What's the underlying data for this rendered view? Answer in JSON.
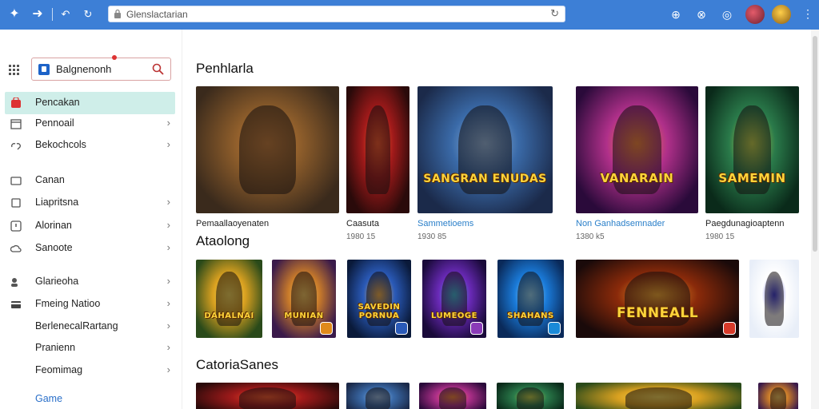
{
  "browser": {
    "url": "Glenslactarian",
    "icons": [
      "sparkle-icon",
      "forward-arrow-icon",
      "back-icon",
      "refresh-icon",
      "lock-icon",
      "reload-icon",
      "zoom-icon",
      "extension-icon",
      "settings-icon",
      "more-icon"
    ]
  },
  "sidebar": {
    "search_value": "Balgnenonh",
    "items": [
      {
        "label": "Pencakan",
        "icon": "shop-icon",
        "active": true,
        "chevron": false
      },
      {
        "label": "Pennoail",
        "icon": "calendar-icon",
        "active": false,
        "chevron": true
      },
      {
        "label": "Bekochcols",
        "icon": "link-icon",
        "active": false,
        "chevron": true
      },
      {
        "label": "Canan",
        "icon": "card-icon",
        "active": false,
        "chevron": false
      },
      {
        "label": "Liapritsna",
        "icon": "square-icon",
        "active": false,
        "chevron": true
      },
      {
        "label": "Alorinan",
        "icon": "info-icon",
        "active": false,
        "chevron": true
      },
      {
        "label": "Sanoote",
        "icon": "cloud-icon",
        "active": false,
        "chevron": true
      },
      {
        "label": "Glarieoha",
        "icon": "people-icon",
        "active": false,
        "chevron": true
      },
      {
        "label": "Fmeing Natioo",
        "icon": "wallet-icon",
        "active": false,
        "chevron": true
      },
      {
        "label": "BerlenecalRartang",
        "icon": "",
        "active": false,
        "chevron": true
      },
      {
        "label": "Pranienn",
        "icon": "",
        "active": false,
        "chevron": true
      },
      {
        "label": "Feomimag",
        "icon": "",
        "active": false,
        "chevron": true
      }
    ],
    "footer_link": "Game"
  },
  "sections": [
    {
      "title": "Penhlarla"
    },
    {
      "title": "Ataolong"
    },
    {
      "title": "CatoriaSanes"
    }
  ],
  "featured": [
    {
      "title": "Pemaallaoyenaten",
      "sub": "",
      "banner": "",
      "highlight": false
    },
    {
      "title": "Caasuta",
      "sub": "1980 15",
      "banner": "",
      "highlight": false
    },
    {
      "title": "Sammetioems",
      "sub": "1930 85",
      "banner": "SANGRAN ENUDAS",
      "highlight": true
    },
    {
      "title": "Non Ganhadsemnader",
      "sub": "1380 k5",
      "banner": "VANARAIN",
      "highlight": true
    },
    {
      "title": "Paegdunagioaptenn",
      "sub": "1980 15",
      "banner": "SAMEMIN",
      "highlight": false
    }
  ],
  "row2": [
    {
      "banner": "DAHALNAI"
    },
    {
      "banner": "MUNIAN"
    },
    {
      "banner": "SAVEDIN PORNUA"
    },
    {
      "banner": "LUMEOGE"
    },
    {
      "banner": "SHAHANS"
    },
    {
      "banner": "FENNEALL"
    },
    {
      "banner": ""
    }
  ],
  "row3": [
    {
      "banner": ""
    },
    {
      "banner": ""
    },
    {
      "banner": ""
    },
    {
      "banner": ""
    },
    {
      "banner": ""
    },
    {
      "banner": ""
    }
  ],
  "colors": {
    "chrome": "#3d7fd6",
    "active_item": "#cfeee9",
    "link": "#2a6fc9",
    "banner_text": "#ffd43a"
  }
}
